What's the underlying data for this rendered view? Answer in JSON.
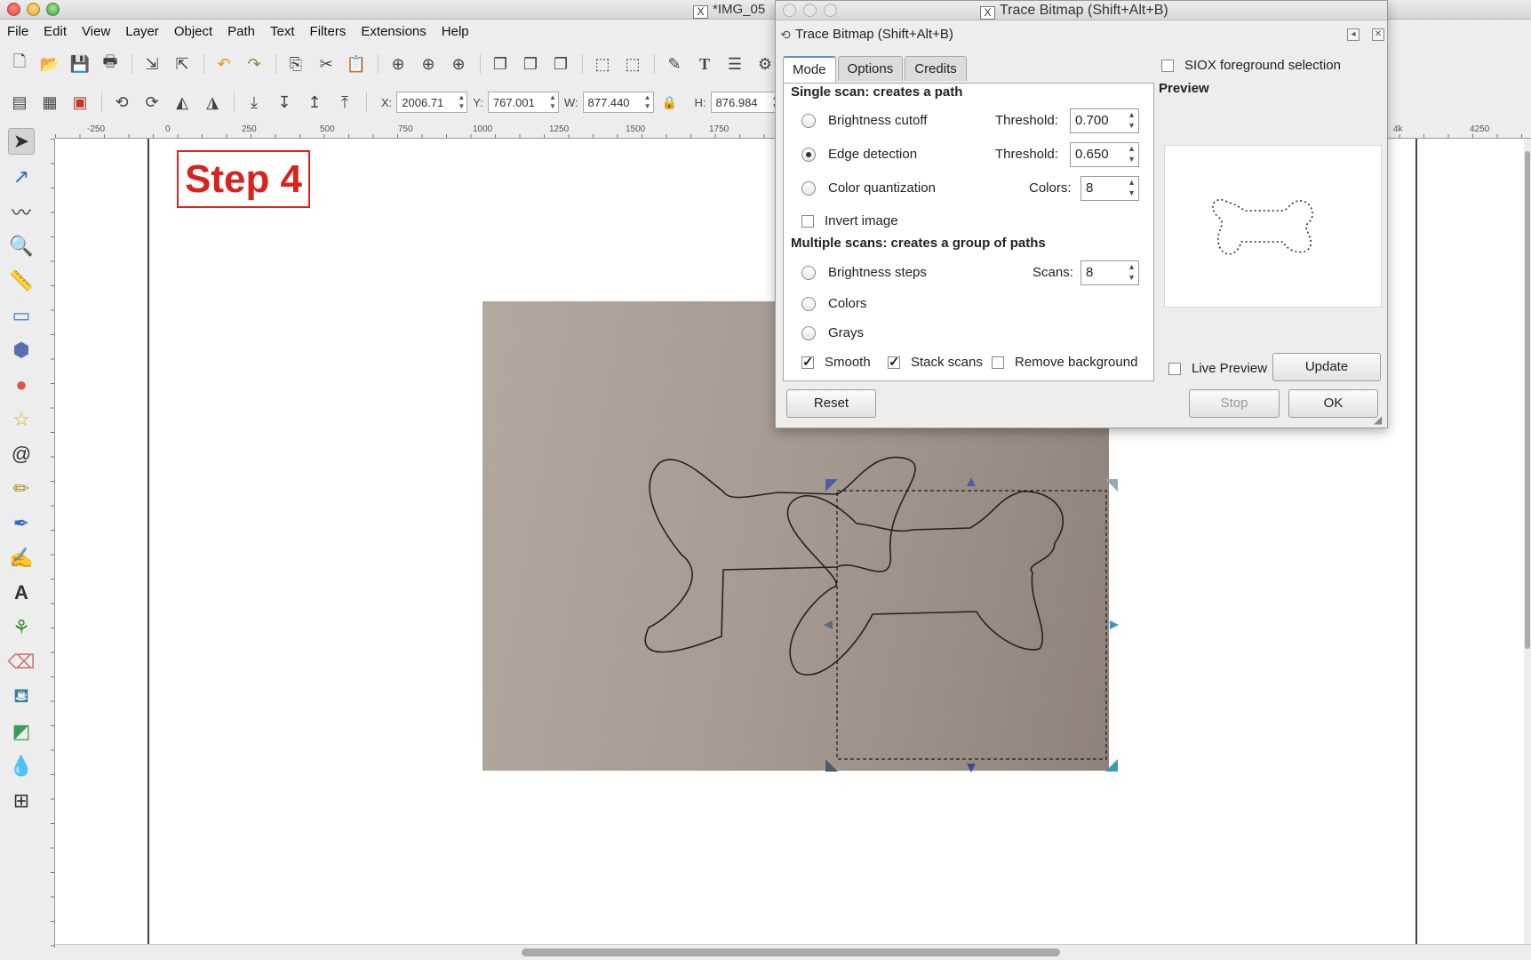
{
  "window": {
    "title": "*IMG_05"
  },
  "menu": [
    "File",
    "Edit",
    "View",
    "Layer",
    "Object",
    "Path",
    "Text",
    "Filters",
    "Extensions",
    "Help"
  ],
  "toolbar2": {
    "x_label": "X:",
    "x_value": "2006.71",
    "y_label": "Y:",
    "y_value": "767.001",
    "w_label": "W:",
    "w_value": "877.440",
    "h_label": "H:",
    "h_value": "876.984"
  },
  "ruler": [
    "-250",
    "0",
    "250",
    "500",
    "750",
    "1000",
    "1250",
    "1500",
    "1750",
    "4k",
    "4250"
  ],
  "canvas": {
    "step_label": "Step 4"
  },
  "dialog": {
    "window_title": "Trace Bitmap (Shift+Alt+B)",
    "header_title": "Trace Bitmap (Shift+Alt+B)",
    "tabs": [
      "Mode",
      "Options",
      "Credits"
    ],
    "single_scan_title": "Single scan: creates a path",
    "brightness_cutoff": "Brightness cutoff",
    "brightness_threshold_label": "Threshold:",
    "brightness_threshold_value": "0.700",
    "edge_detection": "Edge detection",
    "edge_threshold_label": "Threshold:",
    "edge_threshold_value": "0.650",
    "color_quantization": "Color quantization",
    "colors_label": "Colors:",
    "colors_value": "8",
    "invert_image": "Invert image",
    "multiple_scans_title": "Multiple scans: creates a group of paths",
    "brightness_steps": "Brightness steps",
    "scans_label": "Scans:",
    "scans_value": "8",
    "colors_option": "Colors",
    "grays_option": "Grays",
    "smooth": "Smooth",
    "stack_scans": "Stack scans",
    "remove_background": "Remove background",
    "siox": "SIOX foreground selection",
    "preview_label": "Preview",
    "live_preview": "Live Preview",
    "update_button": "Update",
    "reset_button": "Reset",
    "stop_button": "Stop",
    "ok_button": "OK"
  }
}
